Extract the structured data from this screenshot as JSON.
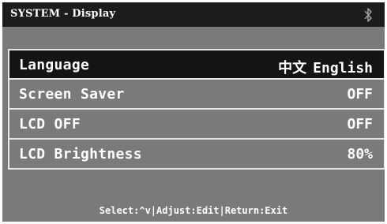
{
  "header": {
    "title": "SYSTEM - Display",
    "status_icon": "bluetooth-icon"
  },
  "menu": {
    "items": [
      {
        "label": "Language",
        "value_options": [
          "中文",
          "English"
        ],
        "selected": true
      },
      {
        "label": "Screen Saver",
        "value": "OFF",
        "selected": false
      },
      {
        "label": "LCD OFF",
        "value": "OFF",
        "selected": false
      },
      {
        "label": "LCD Brightness",
        "value": "80%",
        "selected": false
      }
    ]
  },
  "footer": {
    "hint": "Select:^v|Adjust:Edit|Return:Exit"
  },
  "colors": {
    "background": "#7a7a7a",
    "titlebar": "#1c1c1c",
    "selected_row": "#141414",
    "border": "#e6e6e6",
    "text": "#ffffff"
  }
}
